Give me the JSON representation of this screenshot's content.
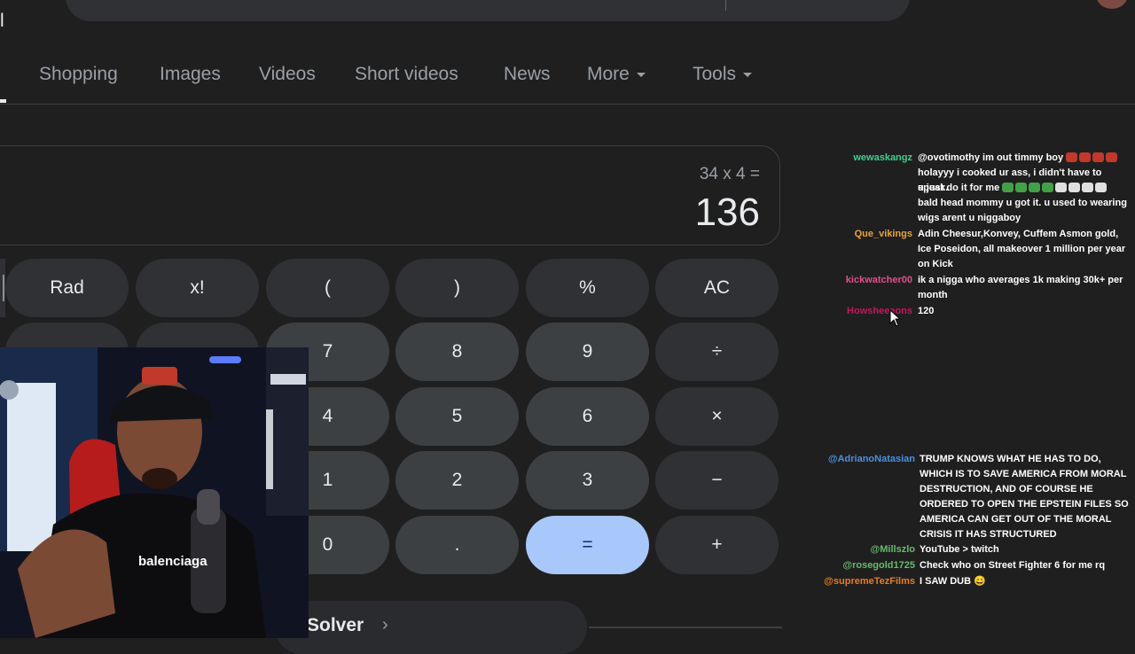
{
  "tabs": {
    "all_fragment": "l",
    "items": [
      {
        "label": "Shopping"
      },
      {
        "label": "Images"
      },
      {
        "label": "Videos"
      },
      {
        "label": "Short videos"
      },
      {
        "label": "News"
      },
      {
        "label": "More",
        "dropdown": true
      },
      {
        "label": "Tools",
        "dropdown": true
      }
    ]
  },
  "calculator": {
    "expression": "34 x 4 =",
    "result": "136",
    "keys": {
      "rad": "Rad",
      "factorial": "x!",
      "open_paren": "(",
      "close_paren": ")",
      "percent": "%",
      "clear": "AC",
      "seven": "7",
      "eight": "8",
      "nine": "9",
      "divide": "÷",
      "four": "4",
      "five": "5",
      "six": "6",
      "multiply": "×",
      "one": "1",
      "two": "2",
      "three": "3",
      "minus": "−",
      "zero": "0",
      "dot": ".",
      "equals": "=",
      "plus": "+"
    },
    "solver_label": "Solver",
    "solver_icon": "chevron-right-icon"
  },
  "webcam": {
    "shirt_text": "balenciaga"
  },
  "chat": {
    "top": [
      {
        "user": "wewaskangz",
        "color": "#3ecf8e",
        "message": "@ovotimothy im out timmy boy"
      },
      {
        "user": "",
        "color": "",
        "message": "holayyy i cooked ur ass, i didn't have to speak."
      },
      {
        "user": "",
        "color": "",
        "message": "u just do it for me"
      },
      {
        "user": "",
        "color": "",
        "message": "bald head mommy u got it. u used to wearing wigs arent u niggaboy"
      },
      {
        "user": "Que_vikings",
        "color": "#e8a33c",
        "message": "Adin Cheesur,Konvey, Cuffem Asmon gold, Ice Poseidon, all makeover 1 million per year on Kick"
      },
      {
        "user": "kickwatcher00",
        "color": "#e0508c",
        "message": "ik a nigga who averages 1k making 30k+ per month"
      },
      {
        "user": "Howsheeeons",
        "color": "#c2185b",
        "message": "120"
      }
    ],
    "bottom": [
      {
        "user": "@AdrianoNatasian",
        "color": "#4a90e2",
        "message": "TRUMP KNOWS WHAT HE HAS TO DO, WHICH IS TO SAVE AMERICA FROM MORAL DESTRUCTION, AND OF COURSE HE ORDERED TO OPEN THE EPSTEIN FILES SO AMERICA CAN GET OUT OF THE MORAL CRISIS IT HAS STRUCTURED"
      },
      {
        "user": "@Millszlo",
        "color": "#66bb6a",
        "message": "YouTube > twitch"
      },
      {
        "user": "@rosegold1725",
        "color": "#66bb6a",
        "message": "Check who on Street Fighter 6 for me rq"
      },
      {
        "user": "@supremeTezFilms",
        "color": "#e67e22",
        "message": "I SAW DUB 😄"
      }
    ]
  },
  "colors": {
    "background": "#1f1f1f",
    "key": "#3c4043",
    "equals_key": "#a8c7fa"
  }
}
